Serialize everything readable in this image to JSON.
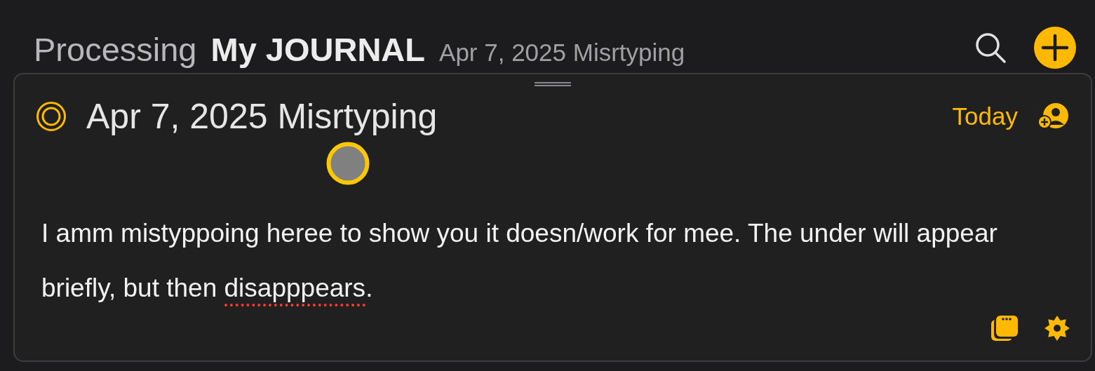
{
  "header": {
    "prefix": "Processing",
    "journal": "My JOURNAL",
    "entry_title": "Apr 7, 2025 Misrtyping"
  },
  "entry": {
    "title": "Apr 7, 2025 Misrtyping",
    "date_label": "Today",
    "body": [
      {
        "text": "I amm mistyppoing heree to show you it doesn/work for mee. The under will appear briefly, but then ",
        "misspelled": false
      },
      {
        "text": "disapppears",
        "misspelled": true
      },
      {
        "text": ".",
        "misspelled": false
      }
    ]
  }
}
